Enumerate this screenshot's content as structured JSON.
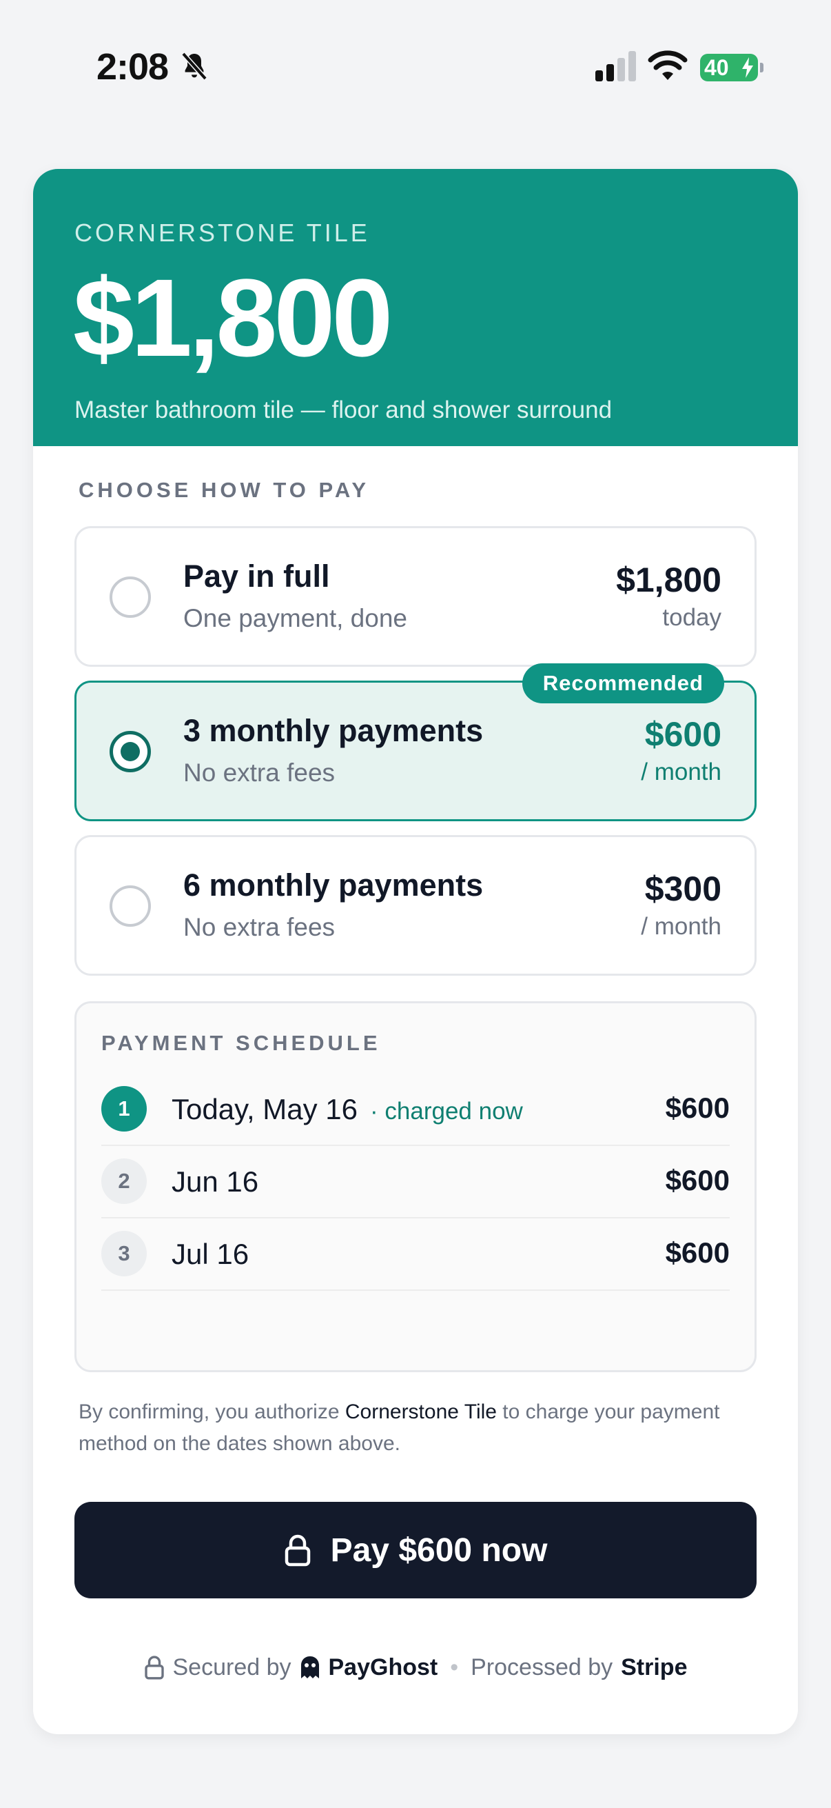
{
  "status_bar": {
    "time": "2:08",
    "battery": "40"
  },
  "hero": {
    "merchant": "CORNERSTONE TILE",
    "amount": "$1,800",
    "description": "Master bathroom tile — floor and shower surround"
  },
  "choose_label": "CHOOSE HOW TO PAY",
  "options": [
    {
      "title": "Pay in full",
      "subtitle": "One payment, done",
      "price": "$1,800",
      "unit": "today",
      "selected": false
    },
    {
      "title": "3 monthly payments",
      "subtitle": "No extra fees",
      "price": "$600",
      "unit": "/ month",
      "selected": true,
      "badge": "Recommended"
    },
    {
      "title": "6 monthly payments",
      "subtitle": "No extra fees",
      "price": "$300",
      "unit": "/ month",
      "selected": false
    }
  ],
  "schedule": {
    "label": "PAYMENT SCHEDULE",
    "rows": [
      {
        "step": "1",
        "date": "Today, May 16",
        "note": "· charged now",
        "amount": "$600"
      },
      {
        "step": "2",
        "date": "Jun 16",
        "note": "",
        "amount": "$600"
      },
      {
        "step": "3",
        "date": "Jul 16",
        "note": "",
        "amount": "$600"
      }
    ]
  },
  "legal": {
    "prefix": "By confirming, you authorize ",
    "merchant": "Cornerstone Tile",
    "suffix": " to charge your payment method on the dates shown above."
  },
  "pay_button": {
    "label": "Pay $600 now"
  },
  "footer": {
    "secured_by": "Secured by",
    "brand": "PayGhost",
    "separator": "•",
    "processed_by": "Processed by",
    "processor": "Stripe"
  },
  "colors": {
    "accent": "#0f9484",
    "button": "#131a2b",
    "selected_bg": "#e6f3f0"
  },
  "icons": [
    "bell-slash-icon",
    "signal-icon",
    "wifi-icon",
    "battery-icon",
    "lock-icon",
    "ghost-icon"
  ]
}
